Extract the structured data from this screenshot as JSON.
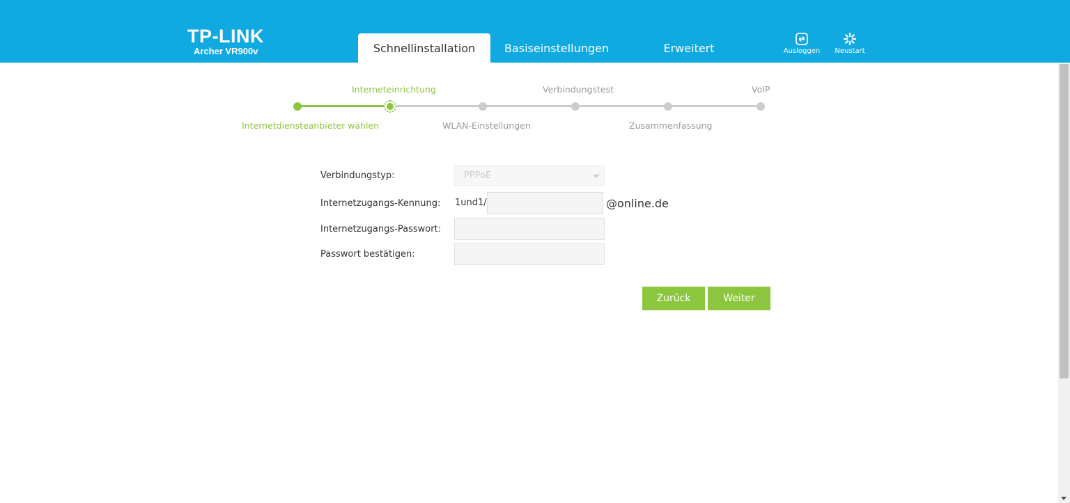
{
  "header": {
    "brand": "TP-LINK",
    "model": "Archer VR900v",
    "tabs": [
      {
        "label": "Schnellinstallation",
        "active": true
      },
      {
        "label": "Basiseinstellungen",
        "active": false
      },
      {
        "label": "Erweitert",
        "active": false
      }
    ],
    "logout_label": "Ausloggen",
    "reboot_label": "Neustart",
    "logout_icon": "logout-icon",
    "reboot_icon": "reboot-spinner-icon"
  },
  "stepper": {
    "steps": [
      {
        "label": "Internetdiensteanbieter wählen",
        "state": "done"
      },
      {
        "label": "Interneteinrichtung",
        "state": "current"
      },
      {
        "label": "WLAN-Einstellungen",
        "state": "pending"
      },
      {
        "label": "Verbindungstest",
        "state": "pending"
      },
      {
        "label": "Zusammenfassung",
        "state": "pending"
      },
      {
        "label": "VoIP",
        "state": "pending"
      }
    ]
  },
  "form": {
    "connection_type_label": "Verbindungstyp:",
    "connection_type_value": "PPPoE",
    "username_label": "Internetzugangs-Kennung:",
    "username_prefix": "1und1/",
    "username_value": "",
    "username_suffix": "@online.de",
    "password_label": "Internetzugangs-Passwort:",
    "password_value": "",
    "confirm_label": "Passwort bestätigen:",
    "confirm_value": ""
  },
  "buttons": {
    "back": "Zurück",
    "next": "Weiter"
  },
  "colors": {
    "header": "#10a9e0",
    "accent": "#8cc63e",
    "inactive": "#cccccc"
  }
}
